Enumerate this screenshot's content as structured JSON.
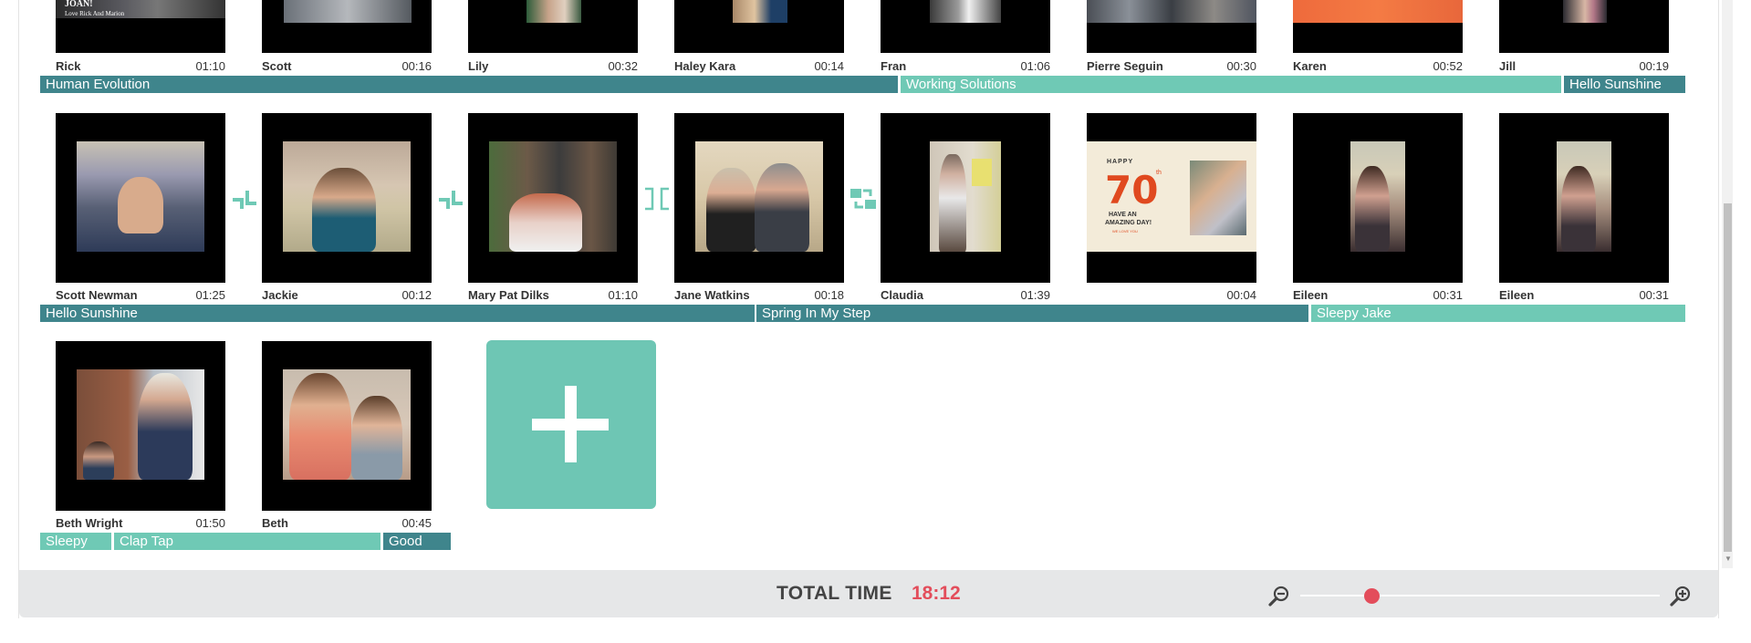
{
  "timeline": {
    "row1": [
      {
        "name": "Rick",
        "duration": "01:10"
      },
      {
        "name": "Scott",
        "duration": "00:16"
      },
      {
        "name": "Lily",
        "duration": "00:32"
      },
      {
        "name": "Haley Kara",
        "duration": "00:14"
      },
      {
        "name": "Fran",
        "duration": "01:06"
      },
      {
        "name": "Pierre Seguin",
        "duration": "00:30"
      },
      {
        "name": "Karen",
        "duration": "00:52"
      },
      {
        "name": "Jill",
        "duration": "00:19"
      }
    ],
    "row1_thumb_text": {
      "line1": "JOAN!",
      "line2": "Love Rick And Marion"
    },
    "row1_music": [
      "Human Evolution",
      "Working Solutions",
      "Hello Sunshine"
    ],
    "row2": [
      {
        "name": "Scott Newman",
        "duration": "01:25"
      },
      {
        "name": "Jackie",
        "duration": "00:12"
      },
      {
        "name": "Mary Pat Dilks",
        "duration": "01:10"
      },
      {
        "name": "Jane Watkins",
        "duration": "00:18"
      },
      {
        "name": "Claudia",
        "duration": "01:39"
      },
      {
        "name": "",
        "duration": "00:04"
      },
      {
        "name": "Eileen",
        "duration": "00:31"
      },
      {
        "name": "Eileen",
        "duration": "00:31"
      }
    ],
    "card70": {
      "happy": "HAPPY",
      "age": "70",
      "suffix": "th",
      "line1": "HAVE AN",
      "line2": "AMAZING DAY!",
      "line3": "WE LOVE YOU"
    },
    "row2_music": [
      "Hello Sunshine",
      "Spring In My Step",
      "Sleepy Jake"
    ],
    "row3": [
      {
        "name": "Beth Wright",
        "duration": "01:50"
      },
      {
        "name": "Beth",
        "duration": "00:45"
      }
    ],
    "row3_music": [
      "Sleepy",
      "Clap Tap",
      "Good"
    ],
    "transitions": [
      "corner-icon",
      "corner-icon",
      "bracket-icon",
      "swap-icon"
    ],
    "add_clip_icon": "plus-icon"
  },
  "footer": {
    "total_label": "TOTAL TIME",
    "total_value": "18:12",
    "zoom_out_icon": "zoom-out-icon",
    "zoom_in_icon": "zoom-in-icon",
    "zoom_level": 0.2
  },
  "colors": {
    "accent": "#6fc9b5",
    "accent_dark": "#3f858c",
    "total": "#e34d5b"
  }
}
